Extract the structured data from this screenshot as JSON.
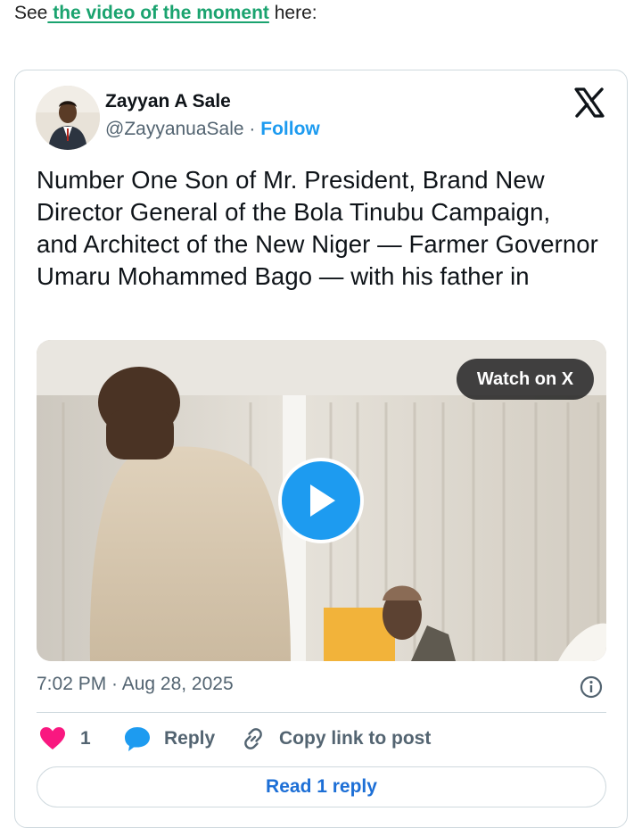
{
  "intro": {
    "prefix": "See",
    "link_text": " the video of the moment",
    "suffix": " here:"
  },
  "tweet": {
    "author_name": "Zayyan A Sale",
    "handle": "@ZayyanuaSale",
    "separator": " · ",
    "follow_label": "Follow",
    "text": "Number One Son of Mr. President, Brand New Director General of the Bola Tinubu Campaign, and Architect of the New Niger — Farmer Governor Umaru Mohammed Bago — with his father in",
    "watch_label": "Watch on X",
    "timestamp": "7:02 PM · Aug 28, 2025",
    "likes_count": "1",
    "reply_label": "Reply",
    "copy_link_label": "Copy link to post",
    "read_reply_label": "Read 1 reply"
  },
  "colors": {
    "link_green": "#1aa36f",
    "accent_blue": "#1d9bf0",
    "heart_pink": "#f91880",
    "muted": "#536471"
  },
  "icons": [
    "x-logo-icon",
    "play-icon",
    "info-icon",
    "heart-icon",
    "reply-bubble-icon",
    "link-icon"
  ]
}
